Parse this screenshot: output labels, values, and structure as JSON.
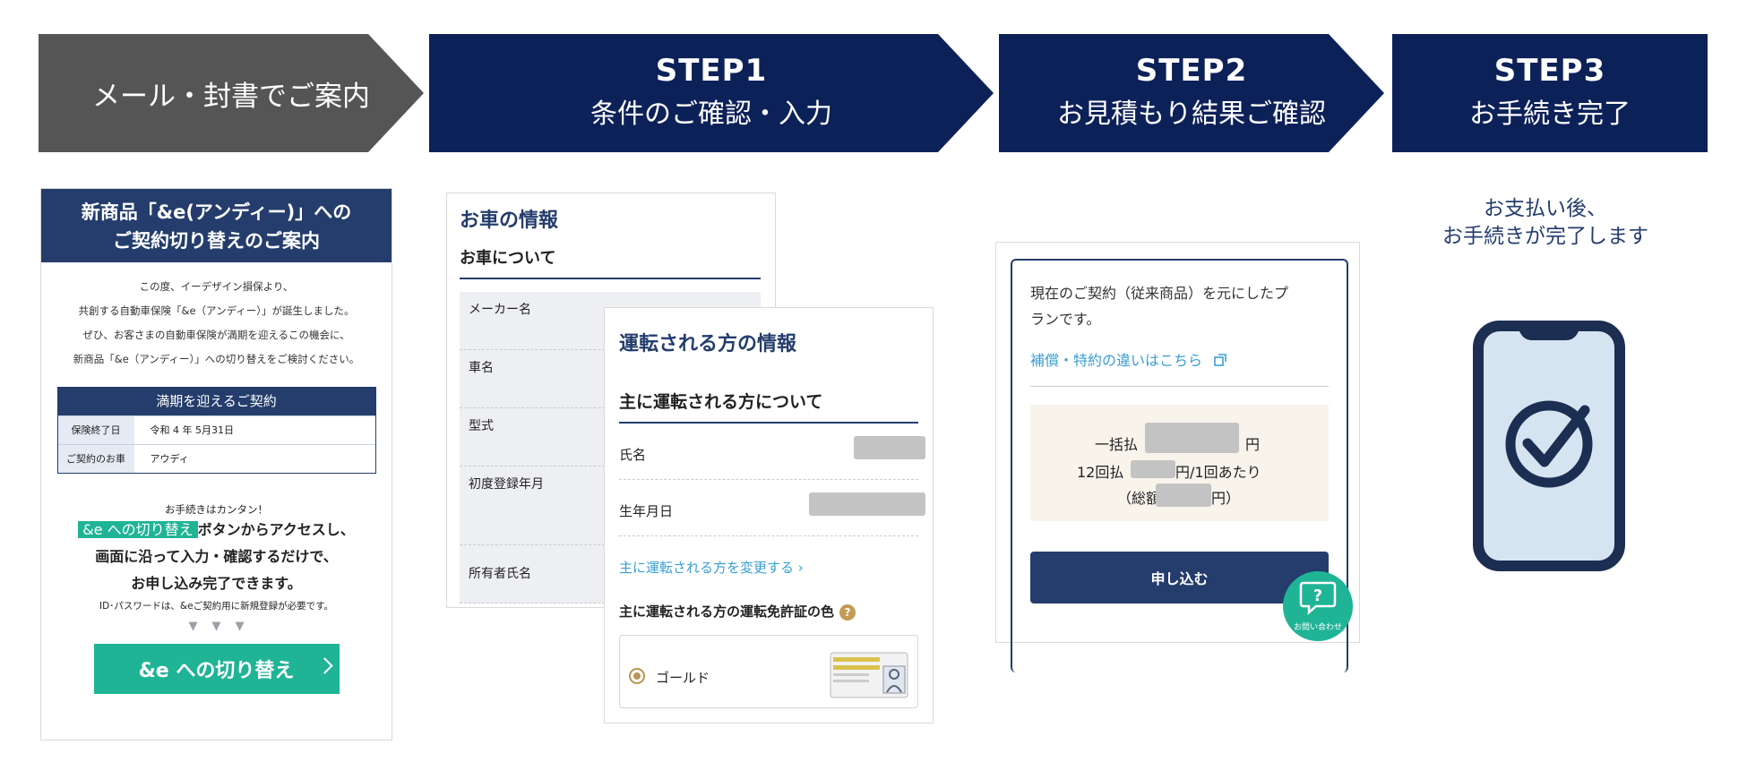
{
  "steps": [
    {
      "step": "",
      "label": "メール・封書でご案内",
      "color": "#555555"
    },
    {
      "step": "STEP1",
      "label": "条件のご確認・入力",
      "color": "#0d2159"
    },
    {
      "step": "STEP2",
      "label": "お見積もり結果ご確認",
      "color": "#0d2159"
    },
    {
      "step": "STEP3",
      "label": "お手続き完了",
      "color": "#0d2159"
    }
  ],
  "mail": {
    "title_line1": "新商品「&e(アンディー)」への",
    "title_line2": "ご契約切り替えのご案内",
    "intro": [
      "この度、イーデザイン損保より、",
      "共創する自動車保険「&e（アンディー）」が誕生しました。",
      "ぜひ、お客さまの自動車保険が満期を迎えるこの機会に、",
      "新商品「&e（アンディー）」への切り替えをご検討ください。"
    ],
    "table_title": "満期を迎えるご契約",
    "table_rows": [
      {
        "key": "保険終了日",
        "value": "令和 4 年 5月31日"
      },
      {
        "key": "ご契約のお車",
        "value": "アウディ"
      }
    ],
    "easy": "お手続きはカンタン！",
    "tag": "&e への切り替え",
    "big1_rest": "ボタンからアクセスし、",
    "big2": "画面に沿って入力・確認するだけで、",
    "big3": "お申し込み完了できます。",
    "note": "ID･パスワードは、&eご契約用に新規登録が必要です。",
    "triangles": "▼▼▼",
    "button": "&e への切り替え"
  },
  "car": {
    "title": "お車の情報",
    "subtitle": "お車について",
    "fields": [
      "メーカー名",
      "車名",
      "型式",
      "初度登録年月",
      "所有者氏名"
    ]
  },
  "driver": {
    "title": "運転される方の情報",
    "subtitle": "主に運転される方について",
    "fields": [
      "氏名",
      "生年月日"
    ],
    "change_link": "主に運転される方を変更する",
    "license_label": "主に運転される方の運転免許証の色",
    "help_mark": "?",
    "gold": "ゴールド"
  },
  "quote": {
    "desc1": "現在のご契約（従来商品）を元にしたプ",
    "desc2": "ランです。",
    "link": "補償・特約の違いはこちら",
    "lump_label": "一括払",
    "yen": "円",
    "installment_label": "12回払",
    "installment_suffix": "円/1回あたり",
    "total_prefix": "（総額",
    "total_suffix": "円）",
    "apply": "申し込む",
    "help_label": "お問い合わせ"
  },
  "done": {
    "line1": "お支払い後、",
    "line2": "お手続きが完了します"
  }
}
